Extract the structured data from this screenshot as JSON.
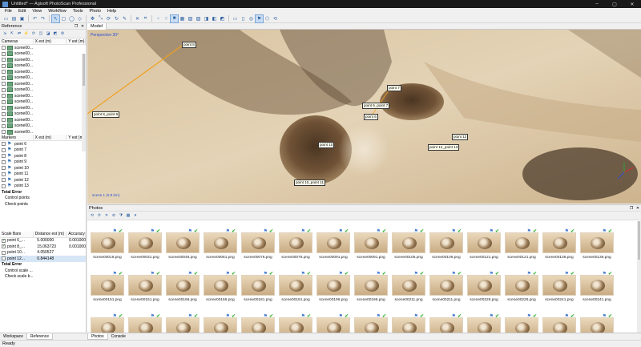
{
  "window": {
    "title": "Untitled* — Agisoft PhotoScan Professional",
    "controls": [
      "–",
      "▢",
      "✕"
    ]
  },
  "menu": [
    "File",
    "Edit",
    "View",
    "Workflow",
    "Tools",
    "Photo",
    "Help"
  ],
  "reference": {
    "panel_title": "Reference",
    "cameras_header": [
      "Cameras",
      "X est (m)",
      "Y est (m)"
    ],
    "cameras": [
      "scene00...",
      "scene00...",
      "scene00...",
      "scene00...",
      "scene00...",
      "scene00...",
      "scene00...",
      "scene00...",
      "scene00...",
      "scene00...",
      "scene00...",
      "scene00...",
      "scene00...",
      "scene00...",
      "scene00...",
      "scene00...",
      "scene00...",
      "scene00..."
    ],
    "markers_header": [
      "Markers",
      "X est (m)",
      "Y est (m)"
    ],
    "markers": [
      "point 6",
      "point 7",
      "point 8",
      "point 9",
      "point 10",
      "point 11",
      "point 12",
      "point 13"
    ],
    "markers_total": "Total Error",
    "markers_sub": [
      "Control points",
      "Check points"
    ],
    "scalebars_header": [
      "Scale Bars",
      "Distance est (m)",
      "Accuracy"
    ],
    "scalebars": [
      {
        "name": "point 6_...",
        "distance": "5.000000",
        "accuracy": "0.001000",
        "checked": true
      },
      {
        "name": "point 8_...",
        "distance": "15.063723",
        "accuracy": "0.001000",
        "checked": true
      },
      {
        "name": "point 10...",
        "distance": "4.050527",
        "accuracy": "",
        "checked": false
      },
      {
        "name": "point 12...",
        "distance": "0.844148",
        "accuracy": "",
        "checked": false
      }
    ],
    "scalebars_total": "Total Error",
    "scalebars_sub": [
      "Control scale ...",
      "Check scale b..."
    ]
  },
  "left_tabs": [
    "Workspace",
    "Reference"
  ],
  "model": {
    "tab": "Model",
    "view_label": "Perspective 30°",
    "markers": [
      {
        "label": "point 8"
      },
      {
        "label": "point 7"
      },
      {
        "label": "point 6_point 7"
      },
      {
        "label": "point 6"
      },
      {
        "label": "point 8_point 9"
      },
      {
        "label": "point 10"
      },
      {
        "label": "point 10_point 11"
      },
      {
        "label": "point 12"
      },
      {
        "label": "point 12_point 13"
      }
    ],
    "scale_text": "scene 1 (0.8 km)"
  },
  "photos": {
    "panel_title": "Photos",
    "row1": [
      "scene00016.png",
      "scene00031.png",
      "scene00046.png",
      "scene00061.png",
      "scene00076.png",
      "scene00076.png",
      "scene00091.png",
      "scene00091.png",
      "scene00106.png",
      "scene00106.png",
      "scene00121.png",
      "scene00121.png",
      "scene00136.png",
      "scene00136.png"
    ],
    "row2": [
      "scene00151.png",
      "scene00151.png",
      "scene00166.png",
      "scene00166.png",
      "scene00181.png",
      "scene00181.png",
      "scene00196.png",
      "scene00196.png",
      "scene00211.png",
      "scene00211.png",
      "scene00226.png",
      "scene00226.png",
      "scene00241.png",
      "scene00241.png"
    ],
    "row3_count": 14
  },
  "photo_tabs": [
    "Photos",
    "Console"
  ],
  "status": "Ready"
}
